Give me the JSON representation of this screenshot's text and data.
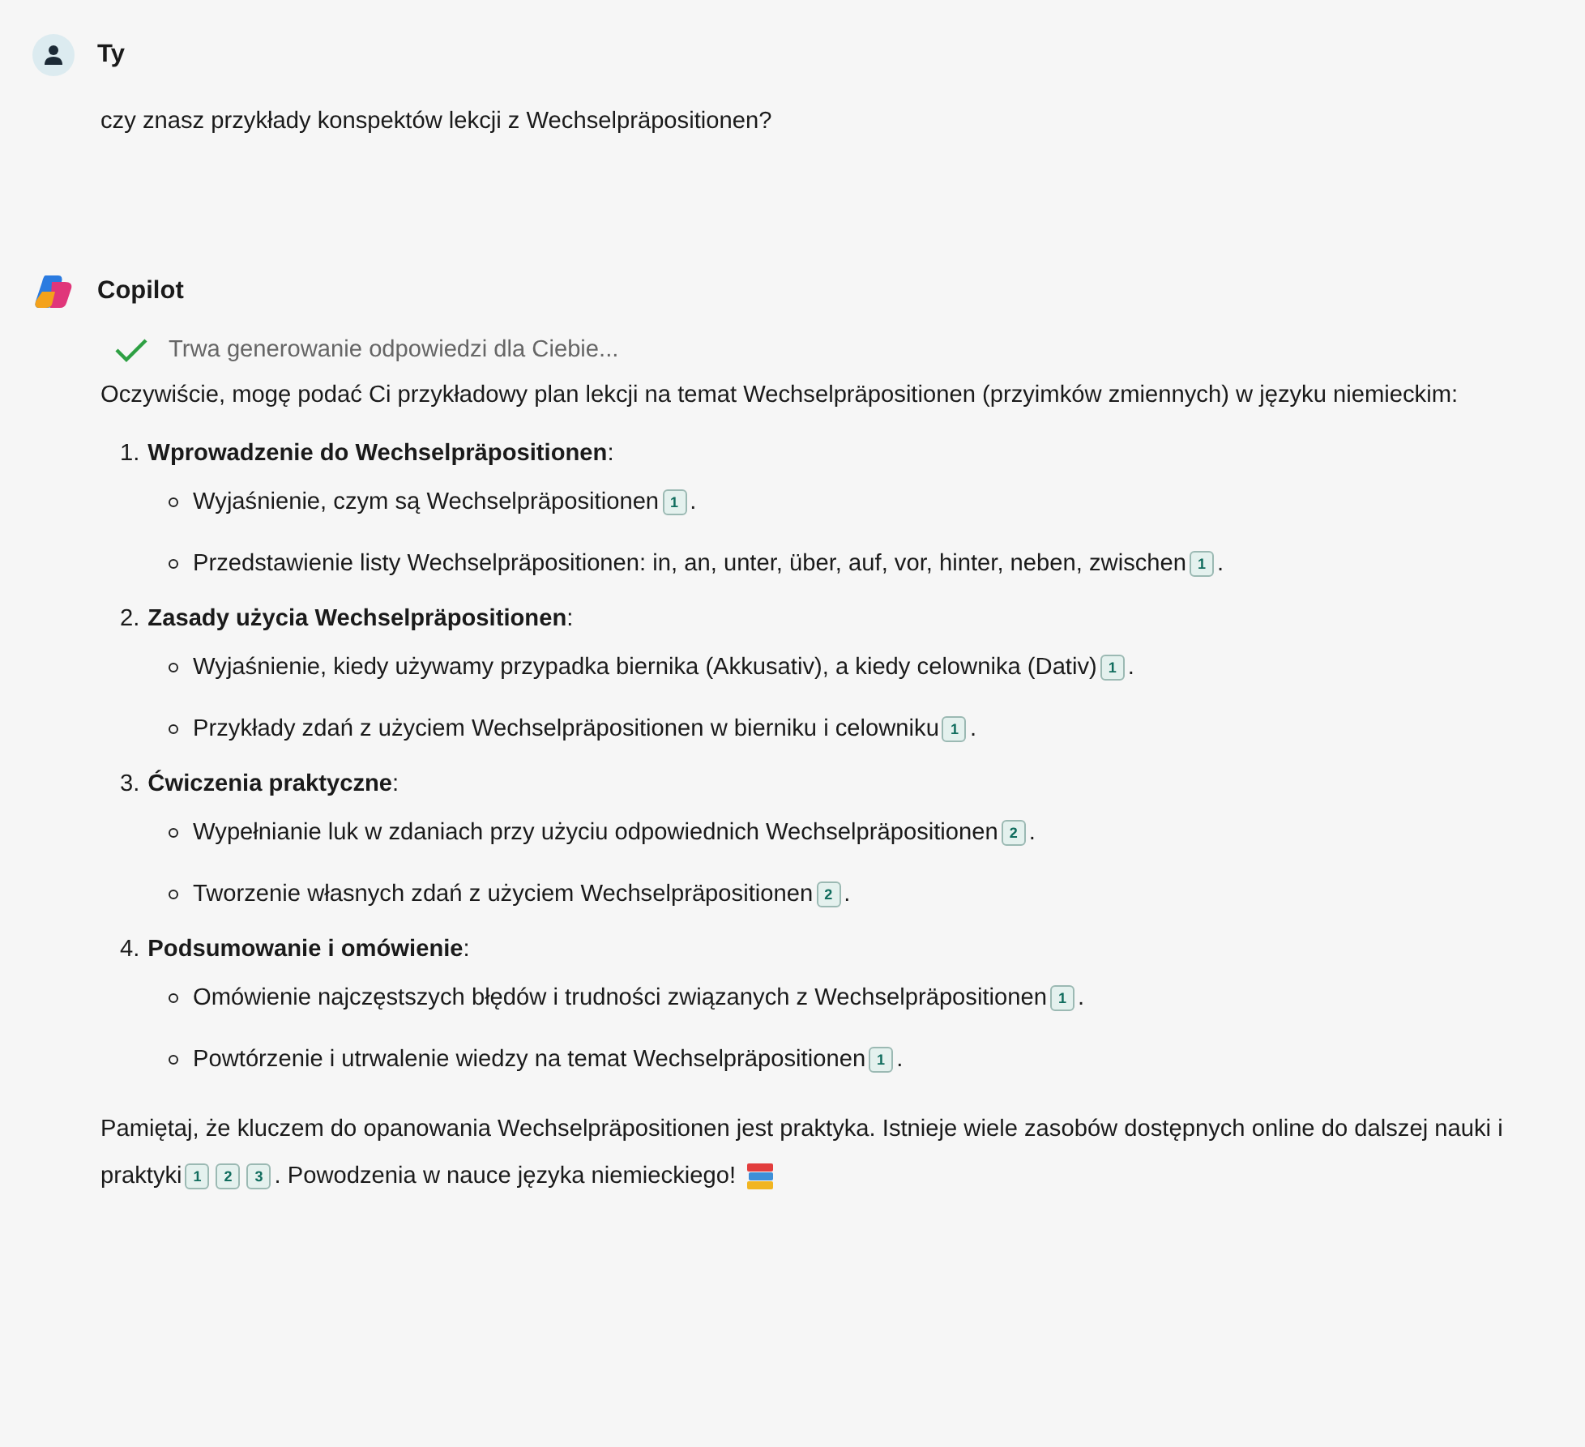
{
  "messages": [
    {
      "kind": "user",
      "author": "Ty",
      "text": "czy znasz przykłady konspektów lekcji z Wechselpräpositionen?"
    },
    {
      "kind": "copilot",
      "author": "Copilot",
      "status": {
        "done": true,
        "text": "Trwa generowanie odpowiedzi dla Ciebie..."
      },
      "intro": "Oczywiście, mogę podać Ci przykładowy plan lekcji na temat Wechselpräpositionen (przyimków zmiennych) w języku niemieckim:",
      "sections": [
        {
          "number": "1.",
          "title": "**Wprowadzenie do Wechselpräpositionen**:",
          "bullets": [
            {
              "text": "Wyjaśnienie, czym są Wechselpräpositionen",
              "citations": [
                "1"
              ],
              "after": "."
            },
            {
              "text": "Przedstawienie listy Wechselpräpositionen: in, an, unter, über, auf, vor, hinter, neben, zwischen",
              "citations": [
                "1"
              ],
              "after": "."
            }
          ]
        },
        {
          "number": "2.",
          "title": "**Zasady użycia Wechselpräpositionen**:",
          "bullets": [
            {
              "text": "Wyjaśnienie, kiedy używamy przypadka biernika (Akkusativ), a kiedy celownika (Dativ)",
              "citations": [
                "1"
              ],
              "after": "."
            },
            {
              "text": "Przykłady zdań z użyciem Wechselpräpositionen w bierniku i celowniku",
              "citations": [
                "1"
              ],
              "after": "."
            }
          ]
        },
        {
          "number": "3.",
          "title": "**Ćwiczenia praktyczne**:",
          "bullets": [
            {
              "text": "Wypełnianie luk w zdaniach przy użyciu odpowiednich Wechselpräpositionen",
              "citations": [
                "2"
              ],
              "after": "."
            },
            {
              "text": "Tworzenie własnych zdań z użyciem Wechselpräpositionen",
              "citations": [
                "2"
              ],
              "after": "."
            }
          ]
        },
        {
          "number": "4.",
          "title": "**Podsumowanie i omówienie**:",
          "bullets": [
            {
              "text": "Omówienie najczęstszych błędów i trudności związanych z Wechselpräpositionen",
              "citations": [
                "1"
              ],
              "after": "."
            },
            {
              "text": "Powtórzenie i utrwalenie wiedzy na temat Wechselpräpositionen",
              "citations": [
                "1"
              ],
              "after": "."
            }
          ]
        }
      ],
      "outro": [
        {
          "kind": "text",
          "text": "Pamiętaj, że kluczem do opanowania Wechselpräpositionen jest praktyka. Istnieje wiele zasobów dostępnych online do dalszej nauki i praktyki"
        },
        {
          "kind": "cite",
          "text": "1"
        },
        {
          "kind": "cite",
          "text": "2"
        },
        {
          "kind": "cite",
          "text": "3"
        },
        {
          "kind": "text",
          "text": ". Powodzenia w nauce języka niemieckiego!"
        },
        {
          "kind": "emoji"
        }
      ]
    }
  ]
}
